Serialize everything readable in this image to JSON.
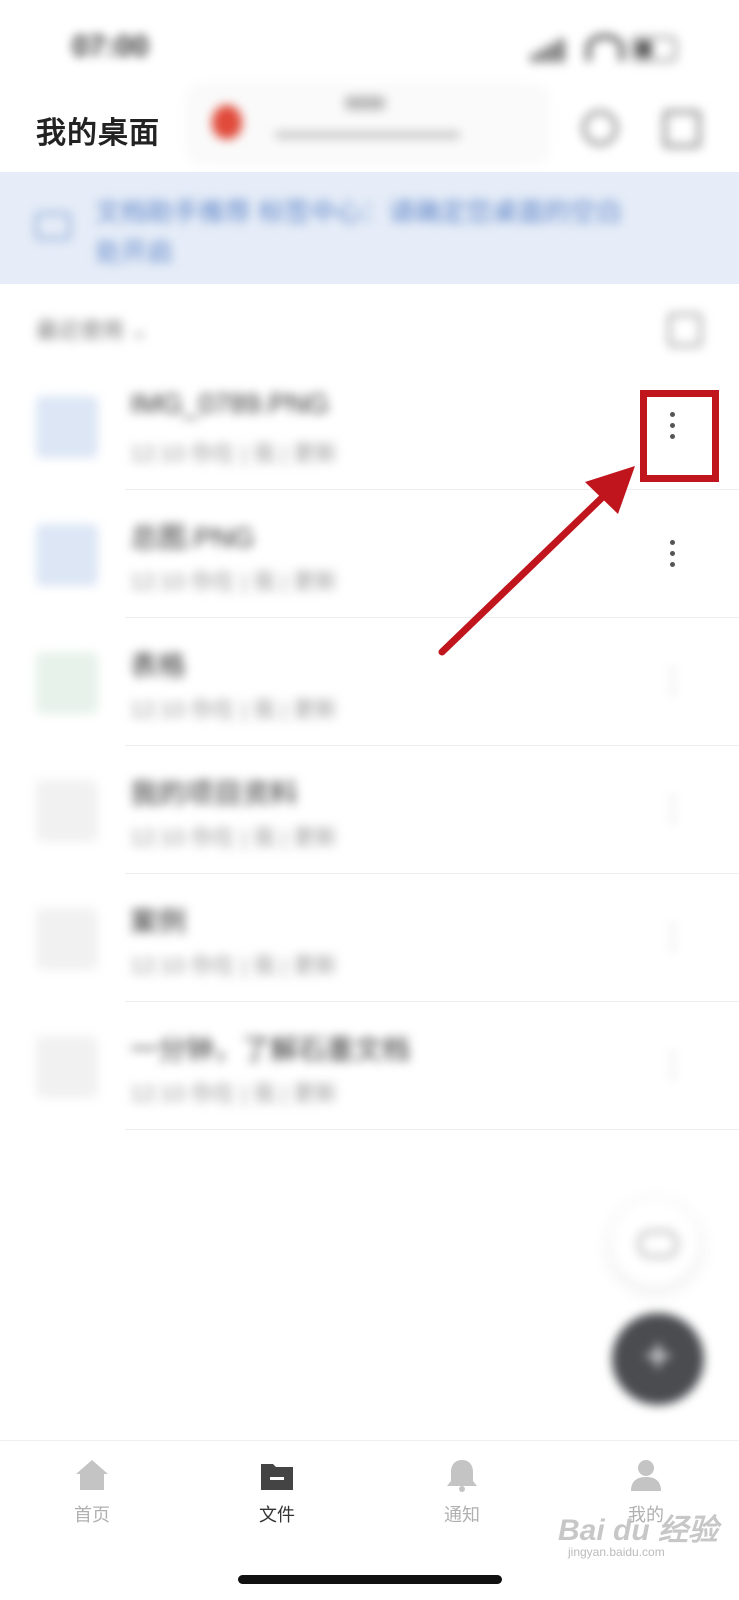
{
  "status_bar": {
    "time": "07:00"
  },
  "header": {
    "title": "我的桌面",
    "card_title": "文件"
  },
  "banner": {
    "text": "文档助手推荐 标签中心：请确定您桌面的空白处开启"
  },
  "sort": {
    "label": "最近使用"
  },
  "files": [
    {
      "name": "IMG_0789.PNG",
      "meta": "12:10 你在 | 我 | 更新",
      "thumb_color": "#dce6f5",
      "more_visible": true
    },
    {
      "name": "总图.PNG",
      "meta": "12:10 你在 | 我 | 更新",
      "thumb_color": "#dce6f5",
      "more_visible": true
    },
    {
      "name": "表格",
      "meta": "12:10 你在 | 我 | 更新",
      "thumb_color": "#e7f2ea",
      "more_visible": false
    },
    {
      "name": "我的项目资料",
      "meta": "12:10 你在 | 我 | 更新",
      "thumb_color": "#f1f1f1",
      "more_visible": false
    },
    {
      "name": "案例",
      "meta": "12:10 你在 | 我 | 更新",
      "thumb_color": "#f1f1f1",
      "more_visible": false
    },
    {
      "name": "一分钟，了解石墨文档",
      "meta": "12:10 你在 | 我 | 更新",
      "thumb_color": "#f1f1f1",
      "more_visible": false
    }
  ],
  "fab": {
    "plus": "+"
  },
  "tabs": [
    {
      "label": "首页",
      "icon": "home-icon",
      "active": false
    },
    {
      "label": "文件",
      "icon": "folder-icon",
      "active": true
    },
    {
      "label": "通知",
      "icon": "bell-icon",
      "active": false
    },
    {
      "label": "我的",
      "icon": "person-icon",
      "active": false
    }
  ],
  "watermark": {
    "text": "Bai du 经验",
    "sub": "jingyan.baidu.com"
  },
  "colors": {
    "annotation": "#c0151c",
    "banner_bg": "#e6edf8",
    "accent_blue": "#5d84c7",
    "fab_dark": "#4a4c50"
  }
}
